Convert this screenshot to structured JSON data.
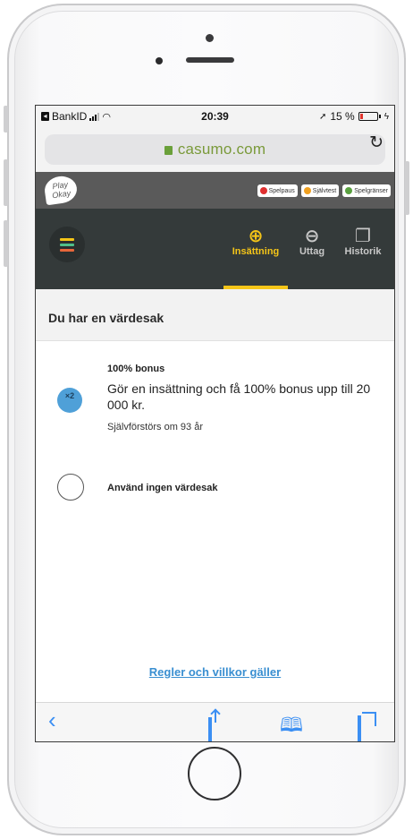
{
  "status_bar": {
    "carrier": "BankID",
    "time": "20:39",
    "battery": "15 %"
  },
  "browser": {
    "url": "casumo.com",
    "reload_icon": "reload-icon",
    "toolbar": {
      "back_icon": "back-arrow-icon",
      "share_icon": "share-icon",
      "bookmarks_icon": "book-icon",
      "tabs_icon": "tabs-icon"
    }
  },
  "rg_strip": {
    "logo_text": "Play Okay",
    "links": [
      {
        "label": "Spelpaus",
        "color": "#e03030"
      },
      {
        "label": "Självtest",
        "color": "#f0a020"
      },
      {
        "label": "Spelgränser",
        "color": "#5aa040"
      }
    ]
  },
  "nav": {
    "tabs": [
      {
        "label": "Insättning",
        "icon": "deposit-icon",
        "active": true
      },
      {
        "label": "Uttag",
        "icon": "withdraw-icon",
        "active": false
      },
      {
        "label": "Historik",
        "icon": "history-icon",
        "active": false
      }
    ],
    "accent": "#f5c518"
  },
  "main": {
    "section_title": "Du har en värdesak",
    "bonus": {
      "badge_text": "×2",
      "title": "100% bonus",
      "description": "Gör en insättning och få 100% bonus upp till 20 000 kr.",
      "expiry": "Självförstörs om 93 år"
    },
    "no_valuable_label": "Använd ingen värdesak",
    "terms_link": "Regler och villkor gäller"
  }
}
